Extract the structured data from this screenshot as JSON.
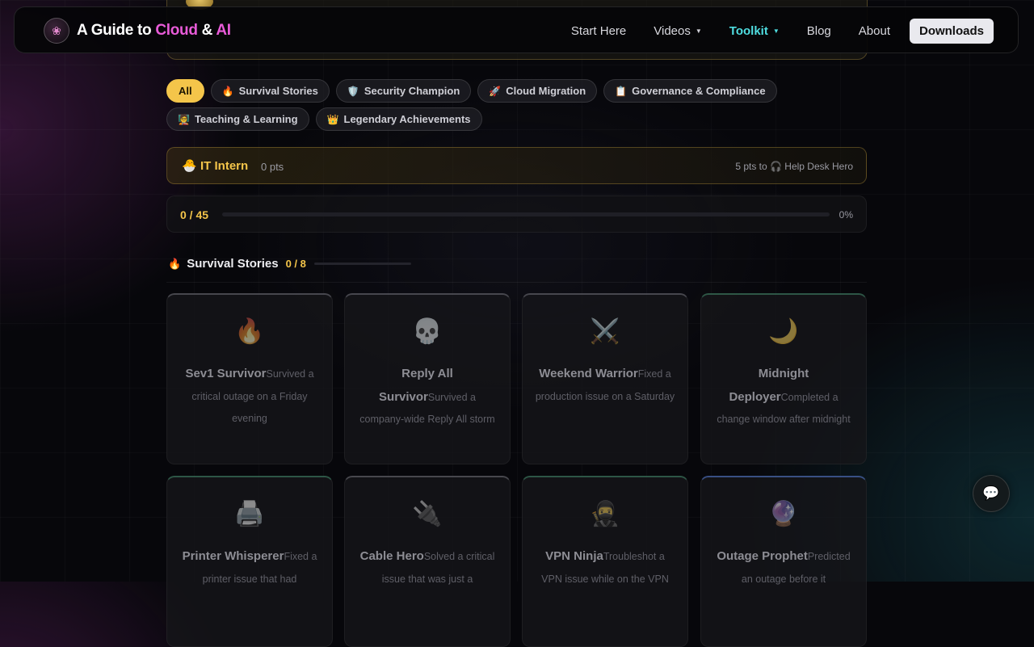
{
  "brand": {
    "prefix": "A Guide to",
    "cloud": "Cloud",
    "amp": "&",
    "ai": "AI"
  },
  "nav": {
    "start_here": "Start Here",
    "videos": "Videos",
    "toolkit": "Toolkit",
    "blog": "Blog",
    "about": "About",
    "downloads": "Downloads"
  },
  "filters": [
    {
      "label": "All",
      "icon": "",
      "active": true
    },
    {
      "label": "Survival Stories",
      "icon": "🔥"
    },
    {
      "label": "Security Champion",
      "icon": "🛡️"
    },
    {
      "label": "Cloud Migration",
      "icon": "🚀"
    },
    {
      "label": "Governance & Compliance",
      "icon": "📋"
    },
    {
      "label": "Teaching & Learning",
      "icon": "🧑‍🏫"
    },
    {
      "label": "Legendary Achievements",
      "icon": "👑"
    }
  ],
  "rank": {
    "icon": "🐣",
    "title": "IT Intern",
    "points": "0 pts",
    "next": "5 pts to 🎧 Help Desk Hero"
  },
  "progress": {
    "count": "0 / 45",
    "percent_label": "0%",
    "fraction": 0.0
  },
  "section": {
    "icon": "🔥",
    "title": "Survival Stories",
    "count": "0 / 8",
    "fraction": 0.0
  },
  "cards": [
    {
      "icon": "🔥",
      "name": "Sev1 Survivor",
      "desc": "Survived a critical outage on a Friday evening",
      "accent": "gray"
    },
    {
      "icon": "💀",
      "name": "Reply All Survivor",
      "desc": "Survived a company-wide Reply All storm",
      "accent": "gray"
    },
    {
      "icon": "⚔️",
      "name": "Weekend Warrior",
      "desc": "Fixed a production issue on a Saturday",
      "accent": "gray"
    },
    {
      "icon": "🌙",
      "name": "Midnight Deployer",
      "desc": "Completed a change window after midnight",
      "accent": "green"
    },
    {
      "icon": "🖨️",
      "name": "Printer Whisperer",
      "desc": "Fixed a printer issue that had",
      "accent": "green"
    },
    {
      "icon": "🔌",
      "name": "Cable Hero",
      "desc": "Solved a critical issue that was just a",
      "accent": "gray"
    },
    {
      "icon": "🥷",
      "name": "VPN Ninja",
      "desc": "Troubleshot a VPN issue while on the VPN",
      "accent": "green"
    },
    {
      "icon": "🔮",
      "name": "Outage Prophet",
      "desc": "Predicted an outage before it",
      "accent": "blue"
    }
  ],
  "chat": {
    "icon": "chat-bubble-icon"
  }
}
